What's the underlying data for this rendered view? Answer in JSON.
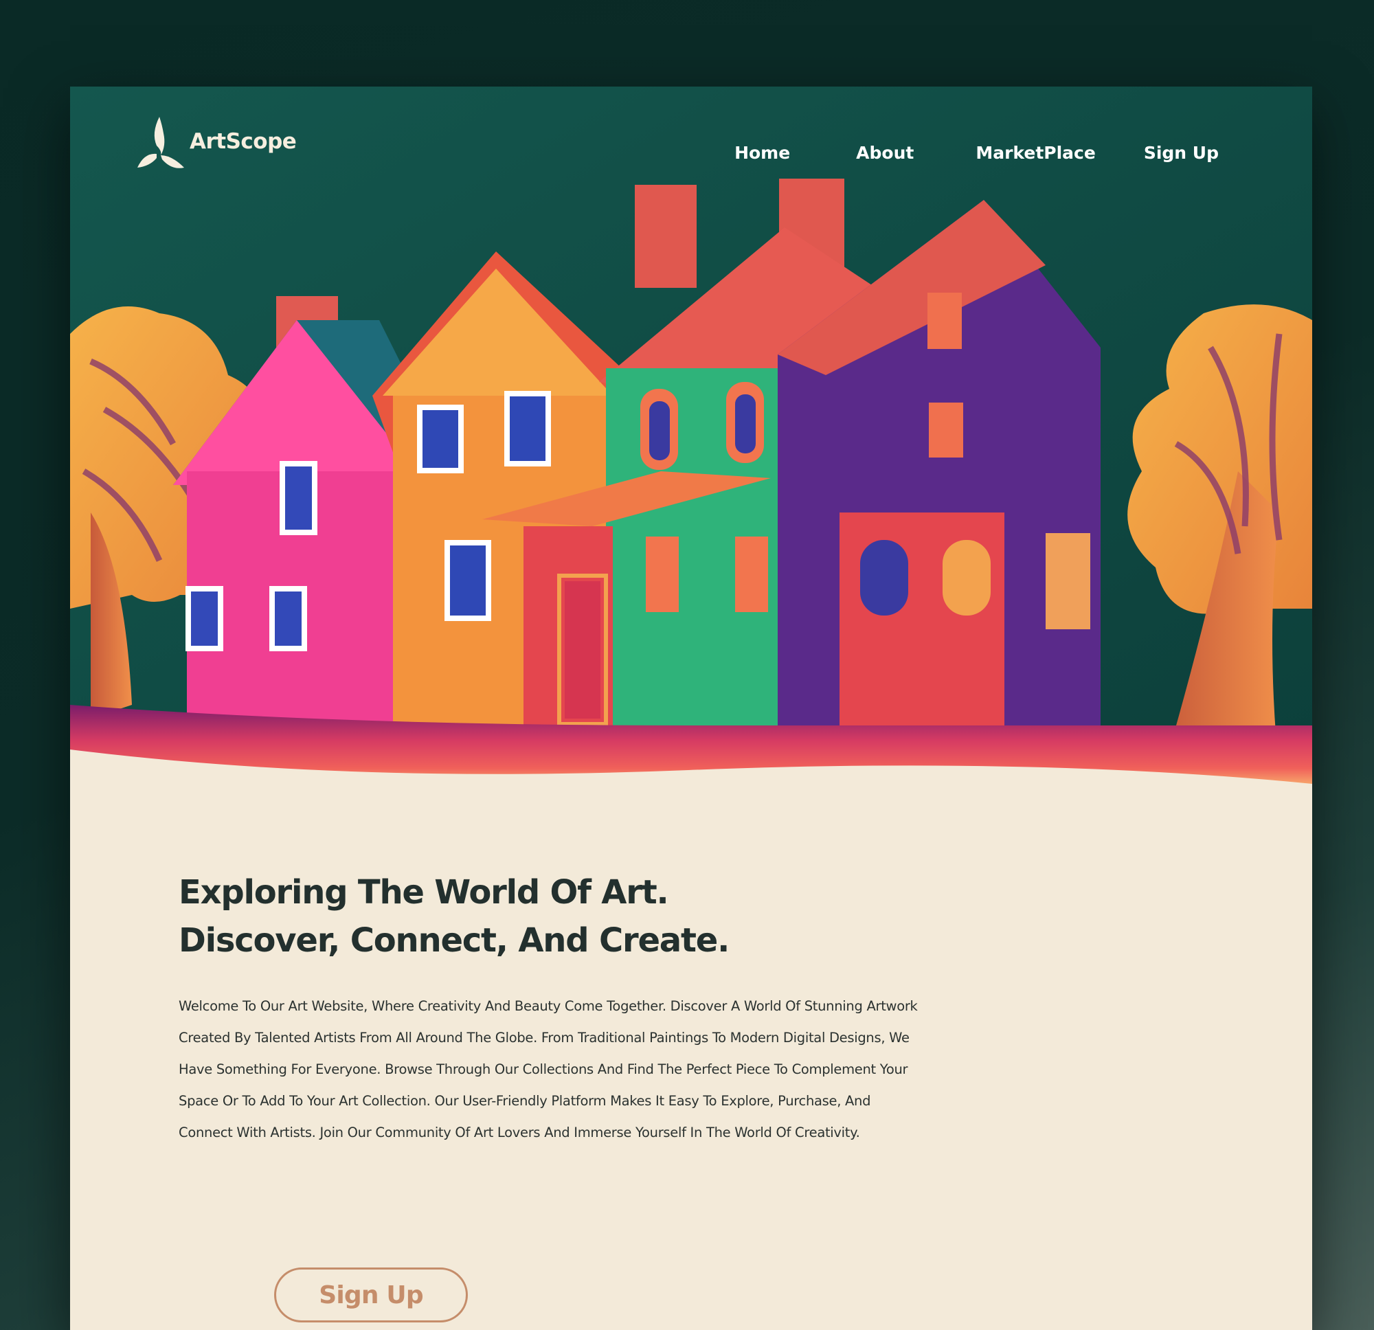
{
  "brand": {
    "name": "ArtScope",
    "logo_icon": "leaf-swirl-logo-icon"
  },
  "nav": {
    "items": [
      {
        "label": "Home"
      },
      {
        "label": "About"
      },
      {
        "label": "MarketPlace"
      },
      {
        "label": "Sign Up"
      }
    ]
  },
  "hero": {
    "image": "painted-colorful-houses-with-autumn-trees-illustration"
  },
  "main": {
    "headline_line1": "Exploring The World Of Art.",
    "headline_line2": "Discover, Connect, And Create.",
    "intro": "Welcome To Our Art Website, Where Creativity And Beauty Come Together. Discover A World Of Stunning Artwork Created By Talented Artists From All Around The Globe. From Traditional Paintings To Modern Digital Designs, We Have Something For Everyone. Browse Through Our Collections And Find The Perfect Piece To Complement Your Space Or To Add To Your Art Collection. Our User-Friendly Platform Makes It Easy To Explore, Purchase, And Connect With Artists. Join Our Community Of Art Lovers And Immerse Yourself In The World Of Creativity.",
    "cta_label": "Sign Up"
  },
  "colors": {
    "outer_background": "#0a2a26",
    "hero_background": "#0f4b44",
    "content_background": "#f3ead9",
    "headline_text": "#23302e",
    "cta_accent": "#c58d6a",
    "nav_text": "#ffffff"
  }
}
